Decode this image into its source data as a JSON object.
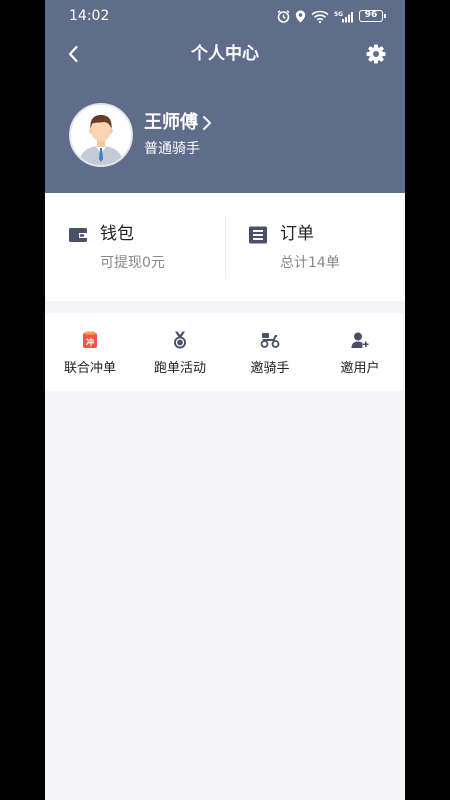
{
  "status_bar": {
    "time": "14:02",
    "battery": "96"
  },
  "nav": {
    "title": "个人中心"
  },
  "profile": {
    "name": "王师傅",
    "role": "普通骑手"
  },
  "stats": {
    "wallet": {
      "title": "钱包",
      "subtitle": "可提现0元"
    },
    "orders": {
      "title": "订单",
      "subtitle": "总计14单"
    }
  },
  "actions": [
    {
      "label": "联合冲单",
      "icon": "rush-order-icon",
      "badge": "冲"
    },
    {
      "label": "跑单活动",
      "icon": "medal-icon"
    },
    {
      "label": "邀骑手",
      "icon": "scooter-icon"
    },
    {
      "label": "邀用户",
      "icon": "add-user-icon"
    }
  ],
  "colors": {
    "header_bg": "#5f6d8b",
    "icon_dark": "#4a5068",
    "accent_red": "#f2554b",
    "page_bg": "#f5f5f7"
  }
}
